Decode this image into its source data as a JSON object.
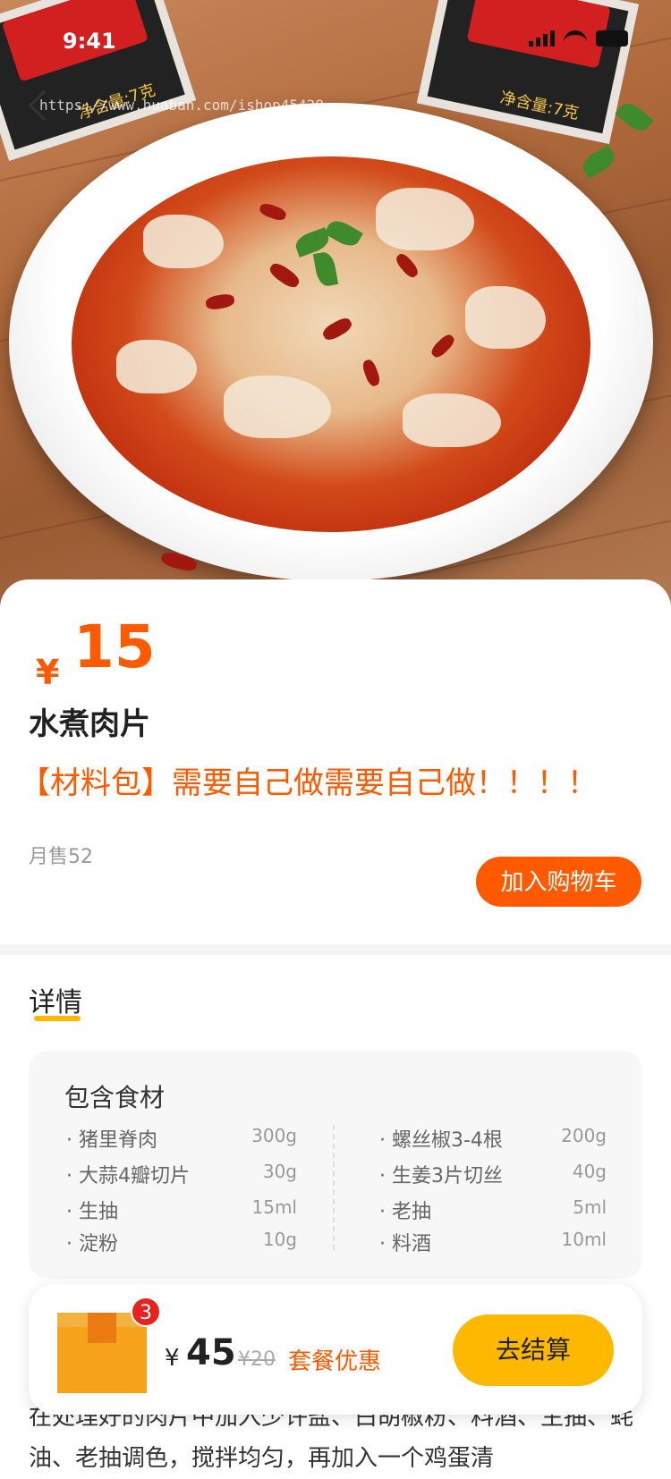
{
  "status_bar": {
    "time": "9:41"
  },
  "watermark": "https://www.huaban.com/ishop45428",
  "hero": {
    "packet_text": "净含量:7克"
  },
  "product": {
    "price_symbol": "¥",
    "price": "15",
    "name": "水煮肉片",
    "subtitle": "【材料包】需要自己做需要自己做！！！！",
    "monthly_sales": "月售52",
    "add_to_cart_label": "加入购物车"
  },
  "details": {
    "title": "详情",
    "ingredients_title": "包含食材",
    "left": [
      {
        "name": "· 猪里脊肉",
        "qty": "300g"
      },
      {
        "name": "· 大蒜4瓣切片",
        "qty": "30g"
      },
      {
        "name": "· 生抽",
        "qty": "15ml"
      },
      {
        "name": "· 淀粉",
        "qty": "10g"
      }
    ],
    "right": [
      {
        "name": "· 螺丝椒3-4根",
        "qty": "200g"
      },
      {
        "name": "· 生姜3片切丝",
        "qty": "40g"
      },
      {
        "name": "· 老抽",
        "qty": "5ml"
      },
      {
        "name": "· 料酒",
        "qty": "10ml"
      }
    ]
  },
  "cart": {
    "badge_count": "3",
    "price_symbol": "¥",
    "total": "45",
    "original_price": "¥20",
    "promo_label": "套餐优惠",
    "checkout_label": "去结算"
  },
  "description": "在处理好的肉片中加入少许盐、白胡椒粉、料酒、生抽、蚝油、老抽调色，搅拌均匀，再加入一个鸡蛋清",
  "colors": {
    "accent": "#ff5a00",
    "checkout": "#ffb800",
    "badge": "#e5231f"
  }
}
